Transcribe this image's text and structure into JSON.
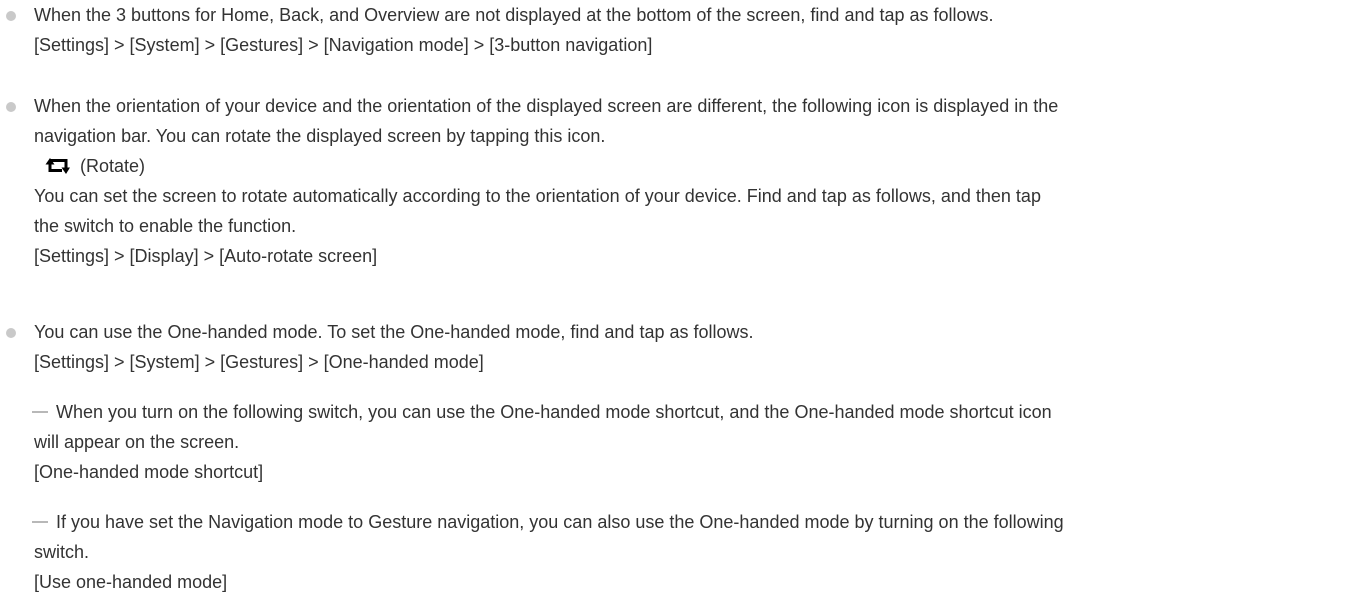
{
  "notes": [
    {
      "lines": [
        "When the 3 buttons for Home, Back, and Overview are not displayed at the bottom of the screen, find and tap as follows.",
        "[Settings] > [System] > [Gestures] > [Navigation mode] > [3-button navigation]"
      ]
    },
    {
      "lines_before_icon": [
        "When the orientation of your device and the orientation of the displayed screen are different, the following icon is displayed in the",
        "navigation bar. You can rotate the displayed screen by tapping this icon."
      ],
      "icon": "rotate-icon",
      "icon_label": "(Rotate)",
      "lines_after_icon": [
        "You can set the screen to rotate automatically according to the orientation of your device. Find and tap as follows, and then tap",
        "the switch to enable the function.",
        "[Settings] > [Display] > [Auto-rotate screen]"
      ]
    },
    {
      "lines": [
        "You can use the One-handed mode. To set the One-handed mode, find and tap as follows.",
        "[Settings] > [System] > [Gestures] > [One-handed mode]"
      ],
      "subnotes": [
        {
          "lines": [
            "When you turn on the following switch, you can use the One-handed mode shortcut, and the One-handed mode shortcut icon",
            "will appear on the screen.",
            "[One-handed mode shortcut]"
          ]
        },
        {
          "lines": [
            "If you have set the Navigation mode to Gesture navigation, you can also use the One-handed mode by turning on the following",
            "switch.",
            "[Use one-handed mode]"
          ]
        }
      ]
    }
  ],
  "colors": {
    "text": "#333333",
    "bullet": "#c9c9c9",
    "dash": "#b8b8b8",
    "icon": "#000000"
  }
}
